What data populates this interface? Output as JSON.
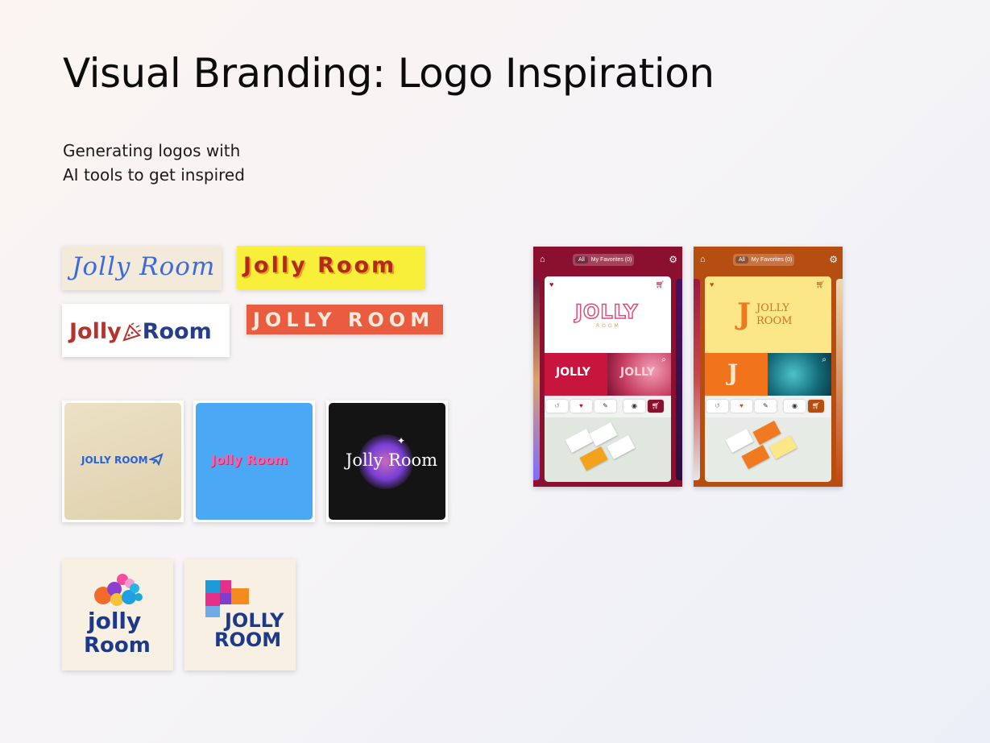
{
  "page": {
    "title": "Visual Branding: Logo Inspiration",
    "subtitle_line1": "Generating logos with",
    "subtitle_line2": "AI tools to get inspired"
  },
  "wordmarks": [
    {
      "text": "Jolly Room",
      "bg": "#f3ead9",
      "color": "#3a6ae0"
    },
    {
      "text": "Jolly Room",
      "bg": "#f7ef3a",
      "color": "#b02a22"
    },
    {
      "text_a": "Jolly",
      "text_b": "Room",
      "bg": "#ffffff",
      "color_a": "#b5332d",
      "color_b": "#253d8a"
    },
    {
      "text": "JOLLY ROOM",
      "bg": "#ea5c3f",
      "color": "#fbeadb"
    }
  ],
  "tiles": [
    {
      "text": "JOLLY ROOM",
      "icon": "plane-icon"
    },
    {
      "text": "Jolly Room"
    },
    {
      "text": "Jolly Room",
      "icon": "sparkle-icon"
    },
    {
      "line1": "jolly",
      "line2": "Room"
    },
    {
      "line1": "JOLLY",
      "line2": "ROOM"
    }
  ],
  "phones": [
    {
      "accent": "#8b0f2f",
      "tab_all": "All",
      "tab_favorites": "My Favorites (0)",
      "hero_logo": "JOLLY",
      "hero_sub": "ROOM",
      "thumb1": "JOLLY",
      "thumb2": "JOLLY"
    },
    {
      "accent": "#b64d11",
      "tab_all": "All",
      "tab_favorites": "My Favorites (0)",
      "hero_letter": "J",
      "hero_line1": "JOLLY",
      "hero_line2": "ROOM",
      "thumb1": "J"
    }
  ]
}
